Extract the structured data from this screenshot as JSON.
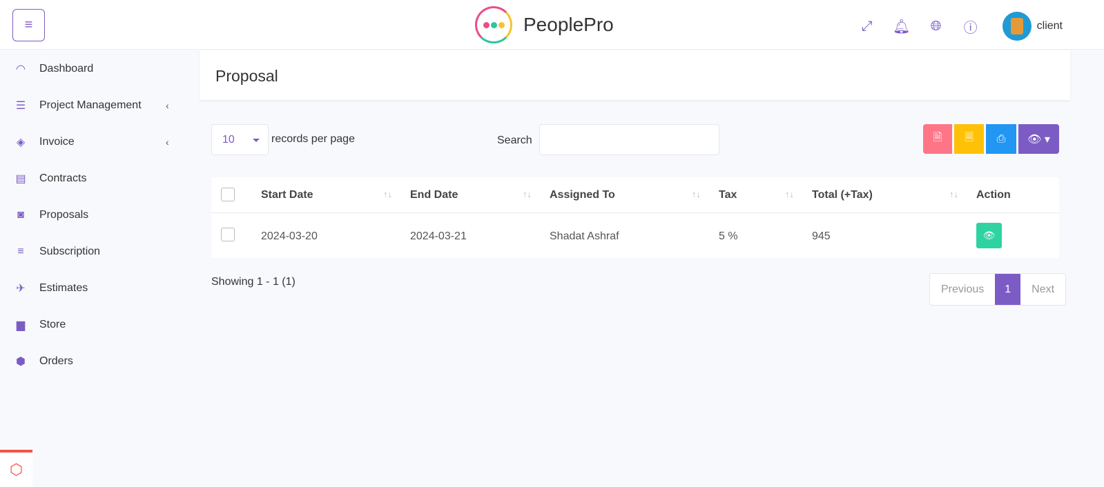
{
  "app": {
    "name": "PeoplePro",
    "user": "client"
  },
  "sidebar": {
    "items": [
      {
        "label": "Dashboard",
        "icon": "gauge-icon",
        "glyph": "◠"
      },
      {
        "label": "Project Management",
        "icon": "list-icon",
        "glyph": "☰",
        "sub": true
      },
      {
        "label": "Invoice",
        "icon": "ticket-icon",
        "glyph": "◈",
        "sub": true
      },
      {
        "label": "Contracts",
        "icon": "file-icon",
        "glyph": "▤"
      },
      {
        "label": "Proposals",
        "icon": "slideshare-icon",
        "glyph": "◙"
      },
      {
        "label": "Subscription",
        "icon": "sliders-icon",
        "glyph": "≡"
      },
      {
        "label": "Estimates",
        "icon": "plane-icon",
        "glyph": "✈"
      },
      {
        "label": "Store",
        "icon": "shopping-bag-icon",
        "glyph": "▆"
      },
      {
        "label": "Orders",
        "icon": "hexagon-icon",
        "glyph": "⬢"
      }
    ],
    "chevron": "‹"
  },
  "page": {
    "title": "Proposal"
  },
  "controls": {
    "per_page": "10",
    "per_page_label": "records per page",
    "search_label": "Search",
    "search_value": ""
  },
  "table": {
    "headers": [
      "Start Date",
      "End Date",
      "Assigned To",
      "Tax",
      "Total (+Tax)",
      "Action"
    ],
    "rows": [
      {
        "start": "2024-03-20",
        "end": "2024-03-21",
        "assigned": "Shadat Ashraf",
        "tax": "5 %",
        "total": "945"
      }
    ]
  },
  "footer": {
    "showing": "Showing 1 - 1 (1)",
    "previous": "Previous",
    "page": "1",
    "next": "Next"
  },
  "colors": {
    "accent": "#7c5cc4",
    "pdf": "#ff7588",
    "csv": "#ffc107",
    "print": "#2196f3",
    "view": "#2ed3a1"
  }
}
